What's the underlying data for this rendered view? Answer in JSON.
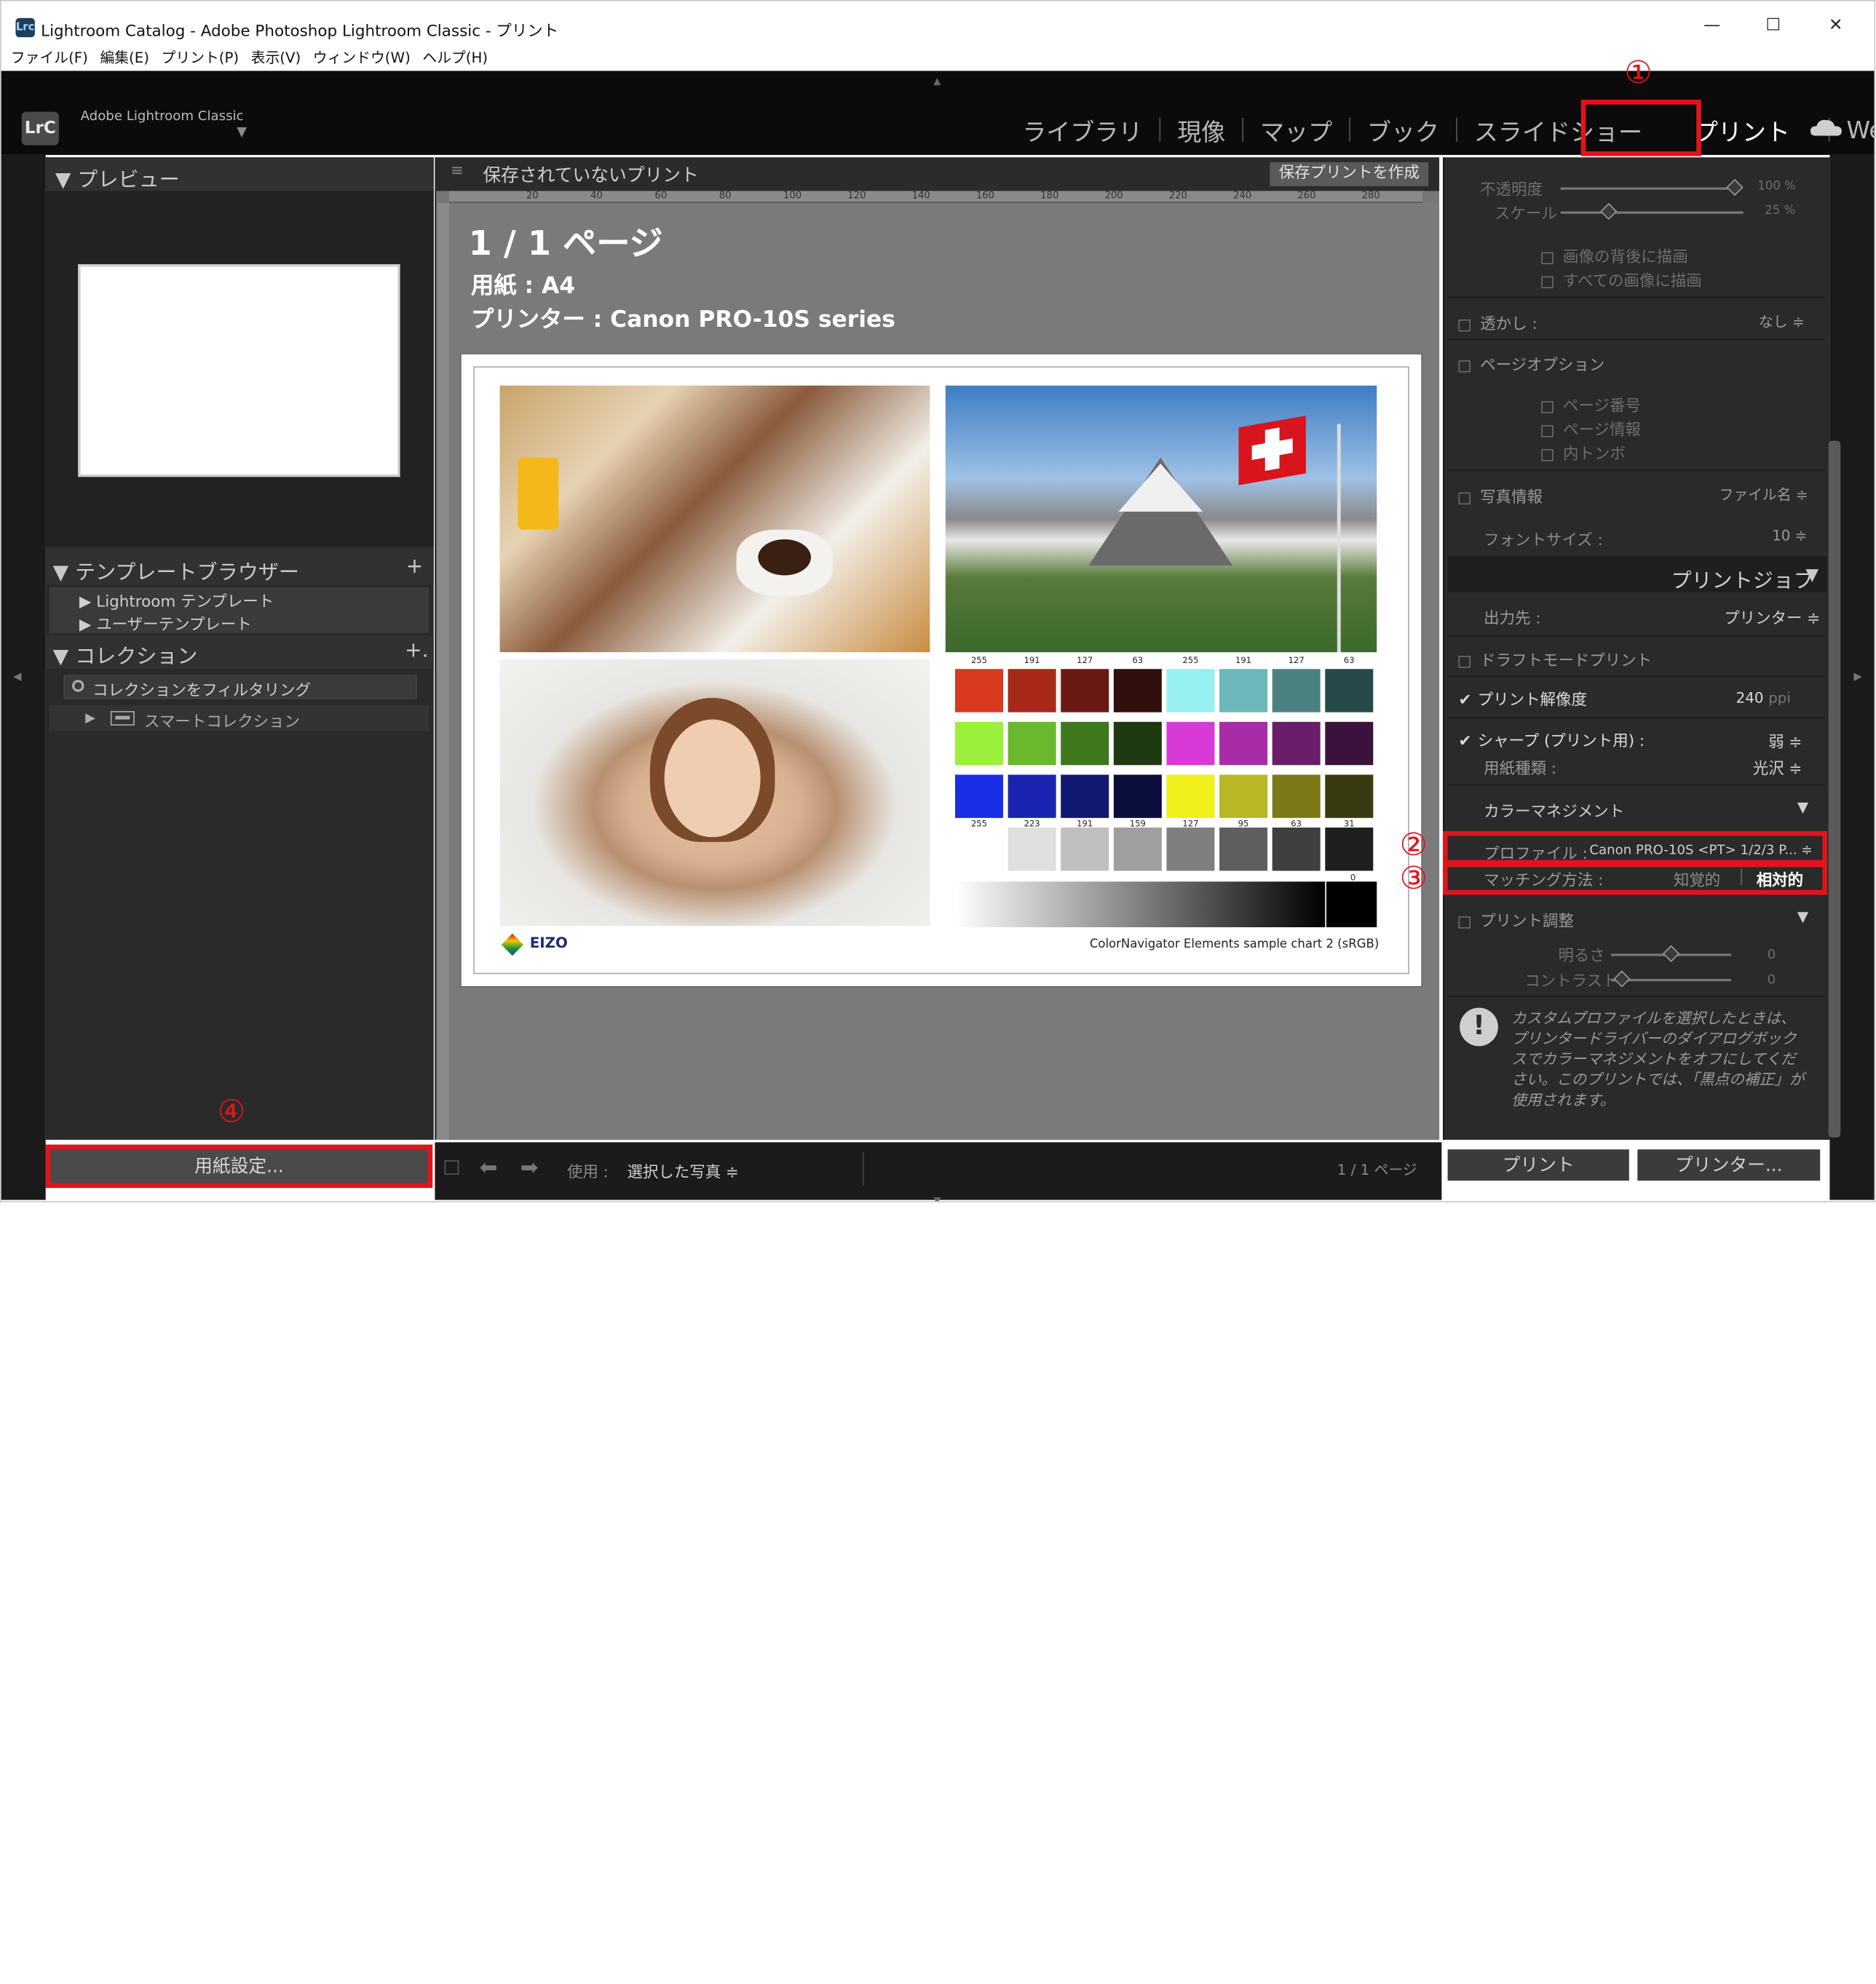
{
  "window": {
    "title": "Lightroom Catalog - Adobe Photoshop Lightroom Classic - プリント",
    "minimize": "—",
    "maximize": "☐",
    "close": "✕"
  },
  "menu": [
    "ファイル(F)",
    "編集(E)",
    "プリント(P)",
    "表示(V)",
    "ウィンドウ(W)",
    "ヘルプ(H)"
  ],
  "brand": {
    "logo": "LrC",
    "name": "Adobe Lightroom Classic"
  },
  "modules": [
    "ライブラリ",
    "現像",
    "マップ",
    "ブック",
    "スライドショー",
    "プリント",
    "Web"
  ],
  "annotations": {
    "n1": "①",
    "n2": "②",
    "n3": "③",
    "n4": "④"
  },
  "left": {
    "preview_header": "▼ プレビュー",
    "template_header": "▼ テンプレートブラウザー",
    "template_add": "+",
    "templates": [
      "▶ Lightroom テンプレート",
      "▶ ユーザーテンプレート"
    ],
    "collection_header": "▼ コレクション",
    "collection_add": "+.",
    "filter": "コレクションをフィルタリング",
    "smart": "スマートコレクション",
    "page_setup": "用紙設定..."
  },
  "center": {
    "title": "保存されていないプリント",
    "save_button": "保存プリントを作成",
    "page_info": "1 / 1 ページ",
    "paper": "用紙 : A4",
    "printer": "プリンター : Canon PRO-10S series",
    "chart_caption": "ColorNavigator Elements sample chart 2  (sRGB)",
    "eizo": "EIZO",
    "ruler_ticks": [
      "20",
      "40",
      "60",
      "80",
      "100",
      "120",
      "140",
      "160",
      "180",
      "200",
      "220",
      "240",
      "260",
      "280"
    ],
    "row1_nums": [
      "255",
      "191",
      "127",
      "63",
      "255",
      "191",
      "127",
      "63"
    ],
    "gray_nums": [
      "255",
      "223",
      "191",
      "159",
      "127",
      "95",
      "63",
      "31"
    ],
    "gray_zero": "0"
  },
  "right": {
    "opacity_label": "不透明度",
    "opacity_value": "100 %",
    "scale_label": "スケール",
    "scale_value": "25 %",
    "draw_behind": "画像の背後に描画",
    "draw_all": "すべての画像に描画",
    "watermark_label": "透かし :",
    "watermark_value": "なし ≑",
    "page_options": "ページオプション",
    "page_number": "ページ番号",
    "page_info": "ページ情報",
    "crop_marks": "内トンボ",
    "photo_info": "写真情報",
    "photo_info_value": "ファイル名 ≑",
    "font_size_label": "フォントサイズ :",
    "font_size_value": "10 ≑",
    "print_job": "プリントジョブ",
    "print_job_arrow": "▼",
    "output_label": "出力先 :",
    "output_value": "プリンター ≑",
    "draft": "ドラフトモードプリント",
    "resolution": "プリント解像度",
    "resolution_value": "240",
    "resolution_unit": "ppi",
    "sharpen": "シャープ (プリント用) :",
    "sharpen_value": "弱 ≑",
    "media_label": "用紙種類 :",
    "media_value": "光沢 ≑",
    "color_mgmt": "カラーマネジメント",
    "color_mgmt_arrow": "▼",
    "profile_label": "プロファイル :",
    "profile_value": "Canon PRO-10S <PT> 1/2/3 P... ≑",
    "matching_label": "マッチング方法 :",
    "matching_perceptual": "知覚的",
    "matching_relative": "相対的",
    "adjust": "プリント調整",
    "adjust_arrow": "▼",
    "brightness_label": "明るさ",
    "brightness_value": "0",
    "contrast_label": "コントラスト",
    "contrast_value": "0",
    "notice": "カスタムプロファイルを選択したときは、プリンタードライバーのダイアログボックスでカラーマネジメントをオフにしてください。このプリントでは、「黒点の補正」が使用されます。",
    "print_button": "プリント",
    "printer_button": "プリンター..."
  },
  "bottom": {
    "use_label": "使用 :",
    "use_value": "選択した写真 ≑",
    "page_count": "1 / 1 ページ"
  },
  "colors": {
    "accent": "#e0141c",
    "panel": "#2a2a2a",
    "swatches_row1": [
      "#d8391f",
      "#a8291a",
      "#6a1a12",
      "#30100c",
      "#98f0f0",
      "#6ab8b8",
      "#4a8282",
      "#264a4a"
    ],
    "swatches_row2": [
      "#9af03a",
      "#6ab82c",
      "#3e781c",
      "#1e3a12",
      "#d83ad8",
      "#a82ca8",
      "#6a1e6a",
      "#3a123a"
    ],
    "swatches_row3": [
      "#1a2ee6",
      "#1a24b0",
      "#121870",
      "#0a0e3a",
      "#f0f01a",
      "#b8b824",
      "#7a7a18",
      "#3a3a10"
    ],
    "swatches_row4": [
      "#ffffff",
      "#dfdfdf",
      "#bfbfbf",
      "#9f9f9f",
      "#7f7f7f",
      "#5f5f5f",
      "#3f3f3f",
      "#1f1f1f"
    ]
  }
}
